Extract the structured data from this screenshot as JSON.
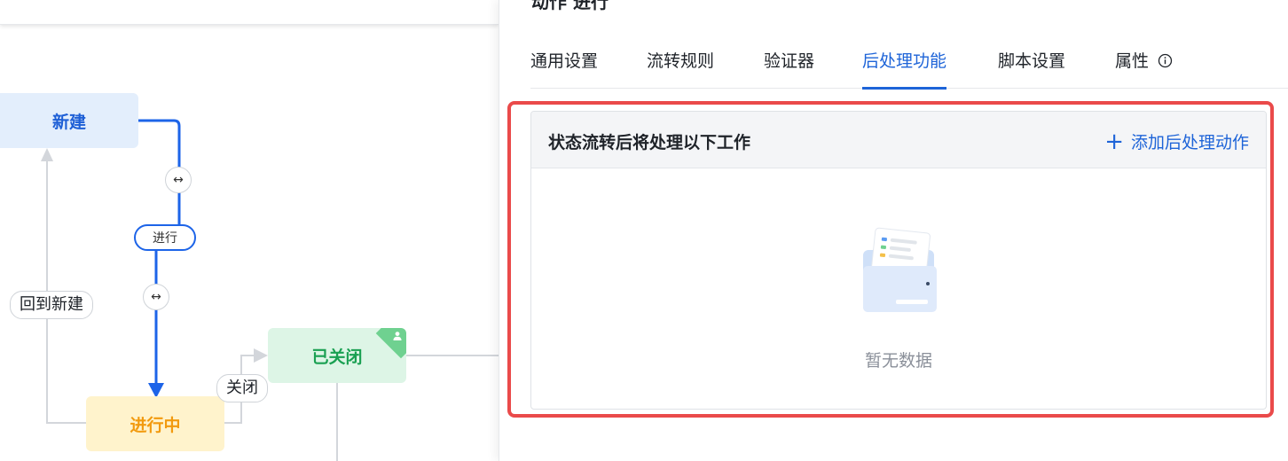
{
  "canvas": {
    "nodes": {
      "new": "新建",
      "closed": "已关闭",
      "in_progress": "进行中"
    },
    "edge_labels": {
      "back_to_new": "回到新建",
      "close": "关闭",
      "transition_pill": "进行"
    },
    "colors": {
      "active_edge": "#1d64e8",
      "inactive_edge": "#d3d6db"
    }
  },
  "panel": {
    "title": "动作 进行",
    "tabs": [
      {
        "label": "通用设置"
      },
      {
        "label": "流转规则"
      },
      {
        "label": "验证器"
      },
      {
        "label": "后处理功能",
        "active": true
      },
      {
        "label": "脚本设置"
      },
      {
        "label": "属性"
      }
    ],
    "post_processing": {
      "header": "状态流转后将处理以下工作",
      "add_action": "添加后处理动作",
      "empty_text": "暂无数据"
    },
    "colors": {
      "accent": "#1e64d8",
      "highlight_border": "#ea4a4a"
    }
  }
}
